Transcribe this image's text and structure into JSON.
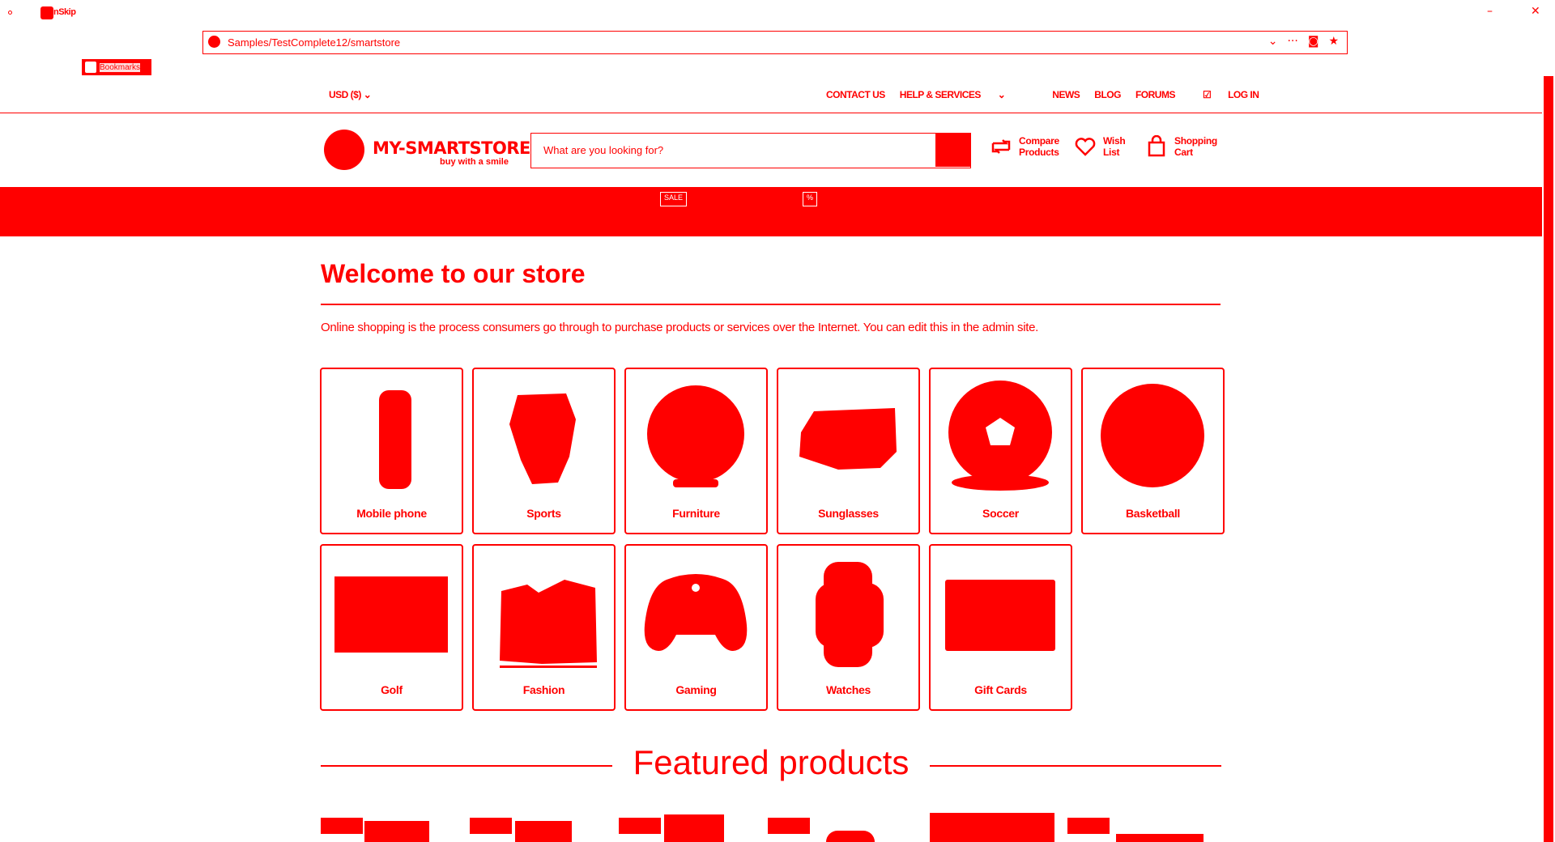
{
  "browser": {
    "tab_title": "nSkip",
    "url": "Samples/TestComplete12/smartstore",
    "extension_label": "Bookmarks",
    "window_controls": {
      "minimize": "–",
      "restore": "❐",
      "close": "✕"
    },
    "url_actions": {
      "dropdown": "⌄",
      "more": "···",
      "pocket": "◙",
      "star": "★"
    }
  },
  "util_bar": {
    "currency": "USD  ($)",
    "links": [
      "CONTACT US",
      "HELP & SERVICES",
      "NEWS",
      "BLOG",
      "FORUMS",
      "LOG IN"
    ]
  },
  "header": {
    "logo_name": "MY-SMARTSTORE",
    "logo_tagline": "buy with a smile",
    "search_placeholder": "What are you looking for?",
    "compare_label": "Compare Products",
    "wishlist_label": "Wish List",
    "cart_label": "Shopping Cart"
  },
  "nav_band": {
    "badges": [
      "SALE",
      "%"
    ]
  },
  "main": {
    "welcome_title": "Welcome to our store",
    "welcome_text": "Online shopping is the process consumers go through to purchase products or services over the Internet. You can edit this in the admin site.",
    "categories": [
      {
        "name": "Mobile phone",
        "icon": "phone-icon"
      },
      {
        "name": "Sports",
        "icon": "sports-icon"
      },
      {
        "name": "Furniture",
        "icon": "lamp-icon"
      },
      {
        "name": "Sunglasses",
        "icon": "sunglasses-icon"
      },
      {
        "name": "Soccer",
        "icon": "soccer-ball-icon"
      },
      {
        "name": "Basketball",
        "icon": "basketball-icon"
      },
      {
        "name": "Golf",
        "icon": "golf-icon"
      },
      {
        "name": "Fashion",
        "icon": "fashion-icon"
      },
      {
        "name": "Gaming",
        "icon": "gamepad-icon"
      },
      {
        "name": "Watches",
        "icon": "watch-icon"
      },
      {
        "name": "Gift Cards",
        "icon": "gift-card-icon"
      }
    ],
    "featured_title": "Featured products"
  },
  "theme": {
    "accent": "#ff0000",
    "background": "#ffffff"
  }
}
